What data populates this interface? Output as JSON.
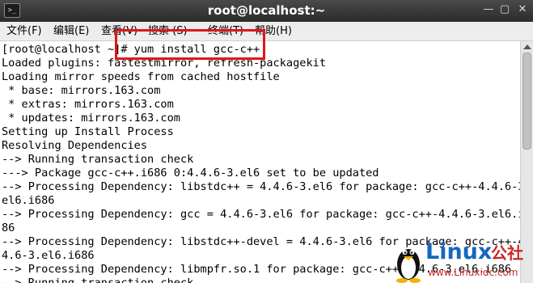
{
  "window": {
    "title": "root@localhost:~",
    "icon_glyph": ">_",
    "controls": {
      "minimize": "—",
      "maximize": "▢",
      "close": "✕"
    }
  },
  "menubar": {
    "items": [
      {
        "label": "文件(F)"
      },
      {
        "label": "编辑(E)"
      },
      {
        "label": "查看(V)"
      },
      {
        "label": "搜索 (S)"
      },
      {
        "label": "终端(T)"
      },
      {
        "label": "帮助(H)"
      }
    ]
  },
  "terminal": {
    "lines": [
      "[root@localhost ~]# yum install gcc-c++",
      "Loaded plugins: fastestmirror, refresh-packagekit",
      "Loading mirror speeds from cached hostfile",
      " * base: mirrors.163.com",
      " * extras: mirrors.163.com",
      " * updates: mirrors.163.com",
      "Setting up Install Process",
      "Resolving Dependencies",
      "--> Running transaction check",
      "---> Package gcc-c++.i686 0:4.4.6-3.el6 set to be updated",
      "--> Processing Dependency: libstdc++ = 4.4.6-3.el6 for package: gcc-c++-4.4.6-3.",
      "el6.i686",
      "--> Processing Dependency: gcc = 4.4.6-3.el6 for package: gcc-c++-4.4.6-3.el6.i6",
      "86",
      "--> Processing Dependency: libstdc++-devel = 4.4.6-3.el6 for package: gcc-c++-4.",
      "4.6-3.el6.i686",
      "--> Processing Dependency: libmpfr.so.1 for package: gcc-c++-4.4.6-3.el6.i686",
      "--> Running transaction check"
    ]
  },
  "annotation": {
    "highlight_color": "#e0161a"
  },
  "watermark": {
    "logo": "Linux",
    "suffix": "公社",
    "url": "www.Linuxidc.com"
  }
}
